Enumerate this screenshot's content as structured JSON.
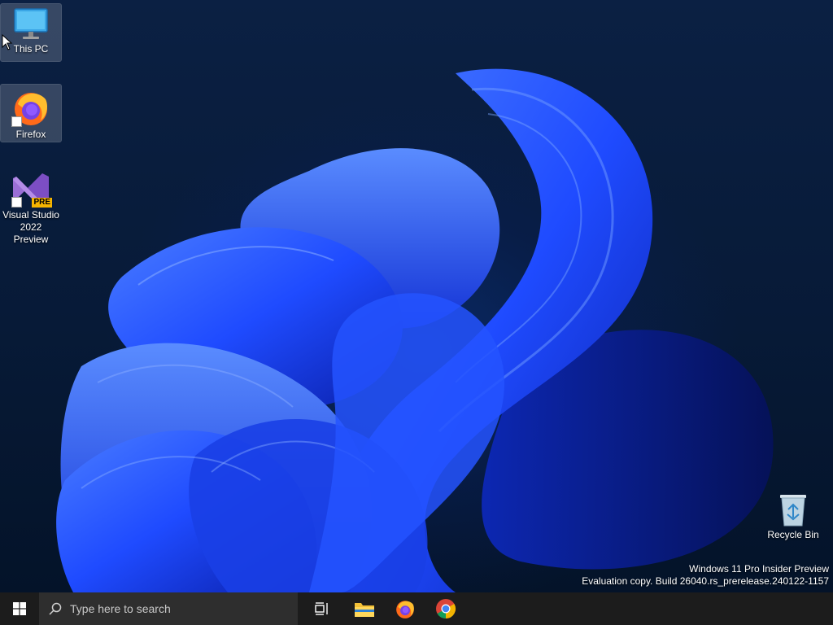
{
  "desktop": {
    "icons": [
      {
        "label": "This PC",
        "icon": "monitor-icon"
      },
      {
        "label": "Firefox",
        "icon": "firefox-icon"
      },
      {
        "label_line1": "Visual Studio",
        "label_line2": "2022 Preview",
        "icon": "visual-studio-preview-icon",
        "badge": "PRE"
      },
      {
        "label": "Recycle Bin",
        "icon": "recycle-bin-icon"
      }
    ]
  },
  "watermark": {
    "line1": "Windows 11 Pro Insider Preview",
    "line2": "Evaluation copy. Build 26040.rs_prerelease.240122-1157"
  },
  "taskbar": {
    "start_icon": "windows-logo-icon",
    "search_placeholder": "Type here to search",
    "pinned": [
      "task-view-icon",
      "file-explorer-icon",
      "firefox-icon",
      "chrome-icon"
    ]
  },
  "colors": {
    "taskbar_bg": "#1c1c1c",
    "search_bg": "#2e2e2e",
    "wallpaper_accent": "#1f4bff"
  }
}
